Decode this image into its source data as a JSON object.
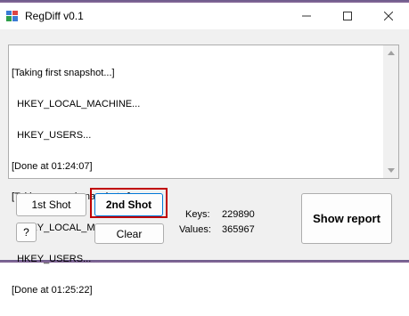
{
  "window": {
    "title": "RegDiff v0.1"
  },
  "log": {
    "lines": [
      "[Taking first snapshot...]",
      "  HKEY_LOCAL_MACHINE...",
      "  HKEY_USERS...",
      "[Done at 01:24:07]",
      "[Taking second snapshot...]",
      "  HKEY_LOCAL_MACHINE...",
      "  HKEY_USERS...",
      "[Done at 01:25:22]"
    ]
  },
  "buttons": {
    "first_shot": "1st Shot",
    "second_shot": "2nd Shot",
    "help": "?",
    "clear": "Clear",
    "show_report": "Show report"
  },
  "stats": {
    "keys_label": "Keys:",
    "keys_value": "229890",
    "values_label": "Values:",
    "values_value": "365967"
  },
  "icons": {
    "app": "regdiff-app-icon",
    "minimize": "minimize-icon",
    "maximize": "maximize-icon",
    "close": "close-icon",
    "scroll_up": "scroll-up-icon",
    "scroll_down": "scroll-down-icon"
  },
  "colors": {
    "highlight_frame": "#c00000",
    "focus_border": "#0078d7"
  }
}
